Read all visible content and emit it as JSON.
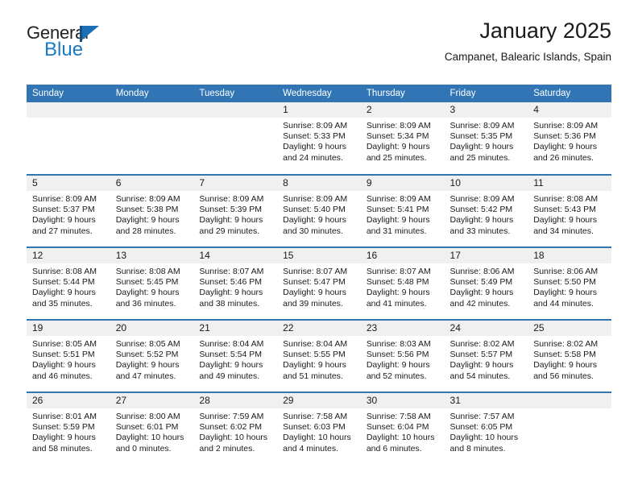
{
  "brand": {
    "line1": "General",
    "line2": "Blue",
    "triangle_icon": "triangle-icon",
    "color_dark": "#231f20",
    "color_blue": "#1a7ac4"
  },
  "header": {
    "title": "January 2025",
    "subtitle": "Campanet, Balearic Islands, Spain"
  },
  "theme": {
    "header_blue": "#3175b4",
    "band_gray": "#f0f0f0",
    "text": "#1a1a1a"
  },
  "weekdays": [
    "Sunday",
    "Monday",
    "Tuesday",
    "Wednesday",
    "Thursday",
    "Friday",
    "Saturday"
  ],
  "labels": {
    "sunrise": "Sunrise:",
    "sunset": "Sunset:",
    "daylight": "Daylight:"
  },
  "weeks": [
    [
      {
        "day": "",
        "l1": "",
        "l2": "",
        "l3": "",
        "l4": ""
      },
      {
        "day": "",
        "l1": "",
        "l2": "",
        "l3": "",
        "l4": ""
      },
      {
        "day": "",
        "l1": "",
        "l2": "",
        "l3": "",
        "l4": ""
      },
      {
        "day": "1",
        "l1": "Sunrise: 8:09 AM",
        "l2": "Sunset: 5:33 PM",
        "l3": "Daylight: 9 hours",
        "l4": "and 24 minutes."
      },
      {
        "day": "2",
        "l1": "Sunrise: 8:09 AM",
        "l2": "Sunset: 5:34 PM",
        "l3": "Daylight: 9 hours",
        "l4": "and 25 minutes."
      },
      {
        "day": "3",
        "l1": "Sunrise: 8:09 AM",
        "l2": "Sunset: 5:35 PM",
        "l3": "Daylight: 9 hours",
        "l4": "and 25 minutes."
      },
      {
        "day": "4",
        "l1": "Sunrise: 8:09 AM",
        "l2": "Sunset: 5:36 PM",
        "l3": "Daylight: 9 hours",
        "l4": "and 26 minutes."
      }
    ],
    [
      {
        "day": "5",
        "l1": "Sunrise: 8:09 AM",
        "l2": "Sunset: 5:37 PM",
        "l3": "Daylight: 9 hours",
        "l4": "and 27 minutes."
      },
      {
        "day": "6",
        "l1": "Sunrise: 8:09 AM",
        "l2": "Sunset: 5:38 PM",
        "l3": "Daylight: 9 hours",
        "l4": "and 28 minutes."
      },
      {
        "day": "7",
        "l1": "Sunrise: 8:09 AM",
        "l2": "Sunset: 5:39 PM",
        "l3": "Daylight: 9 hours",
        "l4": "and 29 minutes."
      },
      {
        "day": "8",
        "l1": "Sunrise: 8:09 AM",
        "l2": "Sunset: 5:40 PM",
        "l3": "Daylight: 9 hours",
        "l4": "and 30 minutes."
      },
      {
        "day": "9",
        "l1": "Sunrise: 8:09 AM",
        "l2": "Sunset: 5:41 PM",
        "l3": "Daylight: 9 hours",
        "l4": "and 31 minutes."
      },
      {
        "day": "10",
        "l1": "Sunrise: 8:09 AM",
        "l2": "Sunset: 5:42 PM",
        "l3": "Daylight: 9 hours",
        "l4": "and 33 minutes."
      },
      {
        "day": "11",
        "l1": "Sunrise: 8:08 AM",
        "l2": "Sunset: 5:43 PM",
        "l3": "Daylight: 9 hours",
        "l4": "and 34 minutes."
      }
    ],
    [
      {
        "day": "12",
        "l1": "Sunrise: 8:08 AM",
        "l2": "Sunset: 5:44 PM",
        "l3": "Daylight: 9 hours",
        "l4": "and 35 minutes."
      },
      {
        "day": "13",
        "l1": "Sunrise: 8:08 AM",
        "l2": "Sunset: 5:45 PM",
        "l3": "Daylight: 9 hours",
        "l4": "and 36 minutes."
      },
      {
        "day": "14",
        "l1": "Sunrise: 8:07 AM",
        "l2": "Sunset: 5:46 PM",
        "l3": "Daylight: 9 hours",
        "l4": "and 38 minutes."
      },
      {
        "day": "15",
        "l1": "Sunrise: 8:07 AM",
        "l2": "Sunset: 5:47 PM",
        "l3": "Daylight: 9 hours",
        "l4": "and 39 minutes."
      },
      {
        "day": "16",
        "l1": "Sunrise: 8:07 AM",
        "l2": "Sunset: 5:48 PM",
        "l3": "Daylight: 9 hours",
        "l4": "and 41 minutes."
      },
      {
        "day": "17",
        "l1": "Sunrise: 8:06 AM",
        "l2": "Sunset: 5:49 PM",
        "l3": "Daylight: 9 hours",
        "l4": "and 42 minutes."
      },
      {
        "day": "18",
        "l1": "Sunrise: 8:06 AM",
        "l2": "Sunset: 5:50 PM",
        "l3": "Daylight: 9 hours",
        "l4": "and 44 minutes."
      }
    ],
    [
      {
        "day": "19",
        "l1": "Sunrise: 8:05 AM",
        "l2": "Sunset: 5:51 PM",
        "l3": "Daylight: 9 hours",
        "l4": "and 46 minutes."
      },
      {
        "day": "20",
        "l1": "Sunrise: 8:05 AM",
        "l2": "Sunset: 5:52 PM",
        "l3": "Daylight: 9 hours",
        "l4": "and 47 minutes."
      },
      {
        "day": "21",
        "l1": "Sunrise: 8:04 AM",
        "l2": "Sunset: 5:54 PM",
        "l3": "Daylight: 9 hours",
        "l4": "and 49 minutes."
      },
      {
        "day": "22",
        "l1": "Sunrise: 8:04 AM",
        "l2": "Sunset: 5:55 PM",
        "l3": "Daylight: 9 hours",
        "l4": "and 51 minutes."
      },
      {
        "day": "23",
        "l1": "Sunrise: 8:03 AM",
        "l2": "Sunset: 5:56 PM",
        "l3": "Daylight: 9 hours",
        "l4": "and 52 minutes."
      },
      {
        "day": "24",
        "l1": "Sunrise: 8:02 AM",
        "l2": "Sunset: 5:57 PM",
        "l3": "Daylight: 9 hours",
        "l4": "and 54 minutes."
      },
      {
        "day": "25",
        "l1": "Sunrise: 8:02 AM",
        "l2": "Sunset: 5:58 PM",
        "l3": "Daylight: 9 hours",
        "l4": "and 56 minutes."
      }
    ],
    [
      {
        "day": "26",
        "l1": "Sunrise: 8:01 AM",
        "l2": "Sunset: 5:59 PM",
        "l3": "Daylight: 9 hours",
        "l4": "and 58 minutes."
      },
      {
        "day": "27",
        "l1": "Sunrise: 8:00 AM",
        "l2": "Sunset: 6:01 PM",
        "l3": "Daylight: 10 hours",
        "l4": "and 0 minutes."
      },
      {
        "day": "28",
        "l1": "Sunrise: 7:59 AM",
        "l2": "Sunset: 6:02 PM",
        "l3": "Daylight: 10 hours",
        "l4": "and 2 minutes."
      },
      {
        "day": "29",
        "l1": "Sunrise: 7:58 AM",
        "l2": "Sunset: 6:03 PM",
        "l3": "Daylight: 10 hours",
        "l4": "and 4 minutes."
      },
      {
        "day": "30",
        "l1": "Sunrise: 7:58 AM",
        "l2": "Sunset: 6:04 PM",
        "l3": "Daylight: 10 hours",
        "l4": "and 6 minutes."
      },
      {
        "day": "31",
        "l1": "Sunrise: 7:57 AM",
        "l2": "Sunset: 6:05 PM",
        "l3": "Daylight: 10 hours",
        "l4": "and 8 minutes."
      },
      {
        "day": "",
        "l1": "",
        "l2": "",
        "l3": "",
        "l4": ""
      }
    ]
  ]
}
